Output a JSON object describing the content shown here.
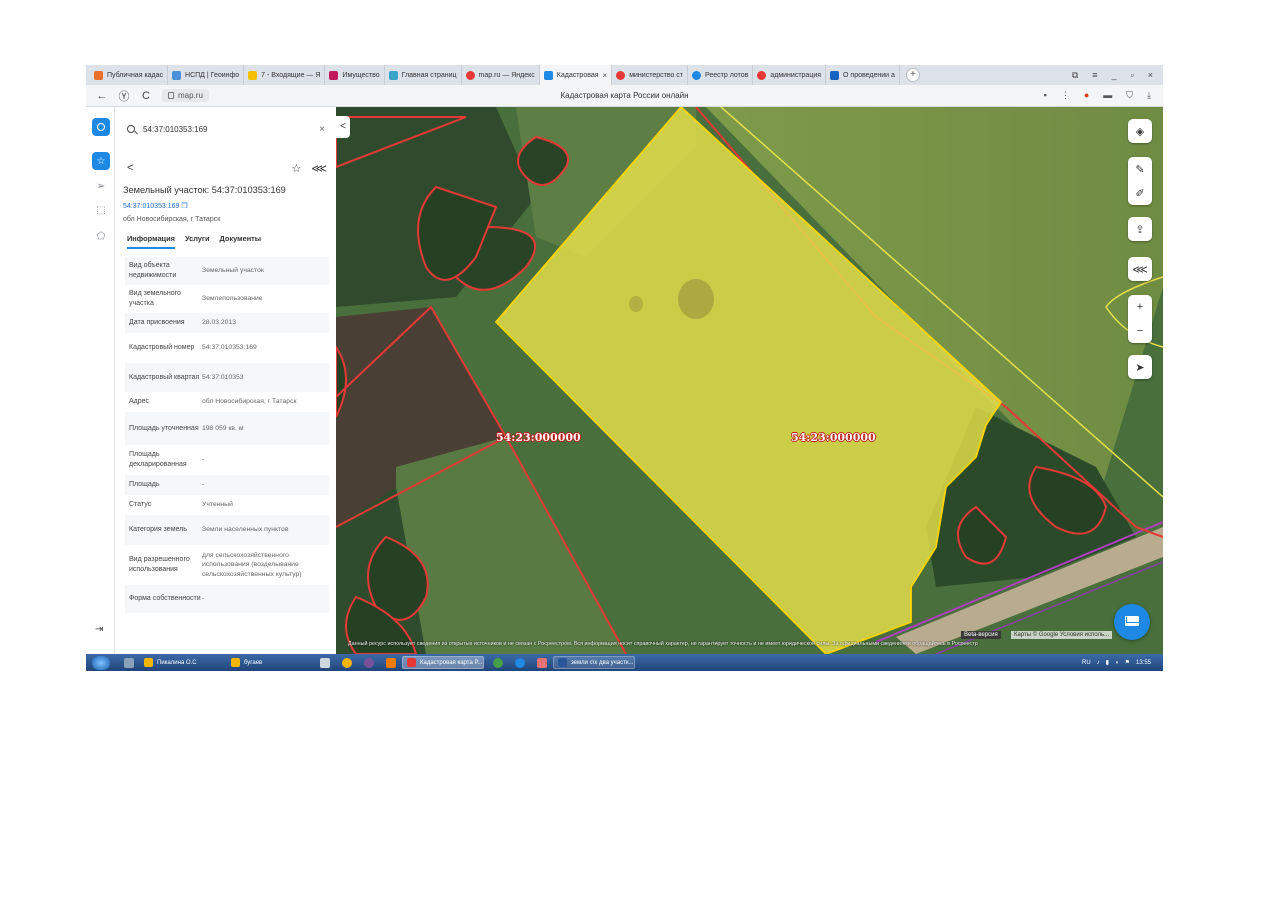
{
  "browser": {
    "tabs": [
      {
        "label": "Публичная кадас",
        "color": "#e8702a",
        "active": false
      },
      {
        "label": "НСПД | Геоинфо",
        "color": "#4a90d9",
        "active": false
      },
      {
        "label": "7 - Входящие — Я",
        "color": "#f5c000",
        "active": false
      },
      {
        "label": "Имущество",
        "color": "#c2185b",
        "active": false
      },
      {
        "label": "Главная страниц",
        "color": "#3aa3c8",
        "active": false
      },
      {
        "label": "map.ru — Яндекс",
        "color": "#e53935",
        "active": false
      },
      {
        "label": "Кадастровая",
        "color": "#1e88e5",
        "active": true,
        "close": "×"
      },
      {
        "label": "министерство ст",
        "color": "#e53935",
        "active": false
      },
      {
        "label": "Реестр лотов",
        "color": "#1e88e5",
        "active": false
      },
      {
        "label": "администрация",
        "color": "#e53935",
        "active": false
      },
      {
        "label": "О проведении а",
        "color": "#1565c0",
        "active": false
      }
    ],
    "new_tab": "+",
    "window_controls": {
      "minimize": "_",
      "restore": "▫",
      "close": "×"
    },
    "tab_menu": [
      "⧉",
      "≡"
    ],
    "url": "map.ru",
    "page_title": "Кадастровая карта России онлайн",
    "nav": {
      "back": "←",
      "yandex": "Ⓨ",
      "reload": "C"
    },
    "addr_icons": [
      "▪",
      "⋮",
      "●",
      "▬",
      "⛉",
      "⤓"
    ]
  },
  "search": {
    "value": "54:37:010353:169",
    "clear": "×"
  },
  "panel": {
    "back": "<",
    "star": "☆",
    "share": "⋘",
    "object_title": "Земельный участок: 54:37:010353:169",
    "object_number": "54:37:010353:169",
    "object_address": "обл Новосибирская, г Татарск",
    "tabs": [
      "Информация",
      "Услуги",
      "Документы"
    ],
    "info": [
      {
        "label": "Вид объекта недвижимости",
        "value": "Земельный участок"
      },
      {
        "label": "Вид земельного участка",
        "value": "Землепользование"
      },
      {
        "label": "Дата присвоения",
        "value": "28.03.2013"
      },
      {
        "label": "Кадастровый номер",
        "value": "54:37:010353:169"
      },
      {
        "label": "Кадастровый квартал",
        "value": "54:37:010353"
      },
      {
        "label": "Адрес",
        "value": "обл Новосибирская, г Татарск"
      },
      {
        "label": "Площадь уточненная",
        "value": "198 059 кв. м"
      },
      {
        "label": "Площадь декларированная",
        "value": "-"
      },
      {
        "label": "Площадь",
        "value": "-"
      },
      {
        "label": "Статус",
        "value": "Учтенный"
      },
      {
        "label": "Категория земель",
        "value": "Земли населенных пунктов"
      },
      {
        "label": "Вид разрешенного использования",
        "value": "для сельскохозяйственного использования (возделывание сельскохозяйственных культур)"
      },
      {
        "label": "Форма собственности",
        "value": "-"
      }
    ]
  },
  "map": {
    "parcel_labels": [
      "54:23:000000",
      "54:23:000000"
    ],
    "collapse": "<",
    "buttons": {
      "layers": "◈",
      "draw": "✎",
      "edit": "✐",
      "upload": "⇪",
      "share": "⋘",
      "zoom_in": "+",
      "zoom_out": "−",
      "locate": "➤"
    },
    "footnote": "Данный ресурс использует сведения из открытых источников и не связан с Росреестром. Вся информация носит справочный характер, не гарантирует точность и не имеет юридической силы. За официальными сведениями обращайтесь в Росреестр",
    "beta": "Beta-версия",
    "attribution": "Карты © Google  Условия исполь...",
    "parcel_color": "#e8e04a",
    "border_color": "#e53935"
  },
  "taskbar": {
    "items": [
      {
        "label": "Пикалина О.С",
        "color": "#f2b705"
      },
      {
        "label": "бугаев",
        "color": "#f2b705"
      },
      {
        "label": "Кадастровая карта Р...",
        "color": "#e53935",
        "active": true
      },
      {
        "label": "земли с\\х два участк...",
        "color": "#2b579a"
      }
    ],
    "lang": "RU",
    "time": "13:55"
  }
}
